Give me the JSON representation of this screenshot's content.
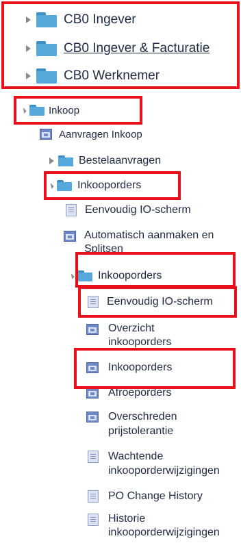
{
  "tree": {
    "top": [
      {
        "label": "CB0 Ingever"
      },
      {
        "label": "CB0 Ingever & Facturatie"
      },
      {
        "label": "CB0 Werknemer"
      }
    ],
    "inkoop": "Inkoop",
    "aanvragen_inkoop": "Aanvragen Inkoop",
    "bestelaanvragen": "Bestelaanvragen",
    "inkooporders_folder": "Inkooporders",
    "eenvoudig_io_1": "Eenvoudig IO-scherm",
    "automatisch_line1": "Automatisch aanmaken en",
    "automatisch_line2": "Splitsen",
    "inkooporders_sub": "Inkooporders",
    "eenvoudig_io_2": "Eenvoudig IO-scherm",
    "overzicht_line1": "Overzicht",
    "overzicht_line2": "inkooporders",
    "inkooporders_item": "Inkooporders",
    "afroeporders": "Afroeporders",
    "overschreden_line1": "Overschreden",
    "overschreden_line2": "prijstolerantie",
    "wachtende_line1": "Wachtende",
    "wachtende_line2": "inkooporderwijzigingen",
    "po_change": "PO Change History",
    "historie_line1": "Historie",
    "historie_line2": "inkooporderwijzigingen"
  },
  "colors": {
    "highlight": "#e8101a",
    "folder": "#56a8db",
    "text": "#1f2a44"
  }
}
